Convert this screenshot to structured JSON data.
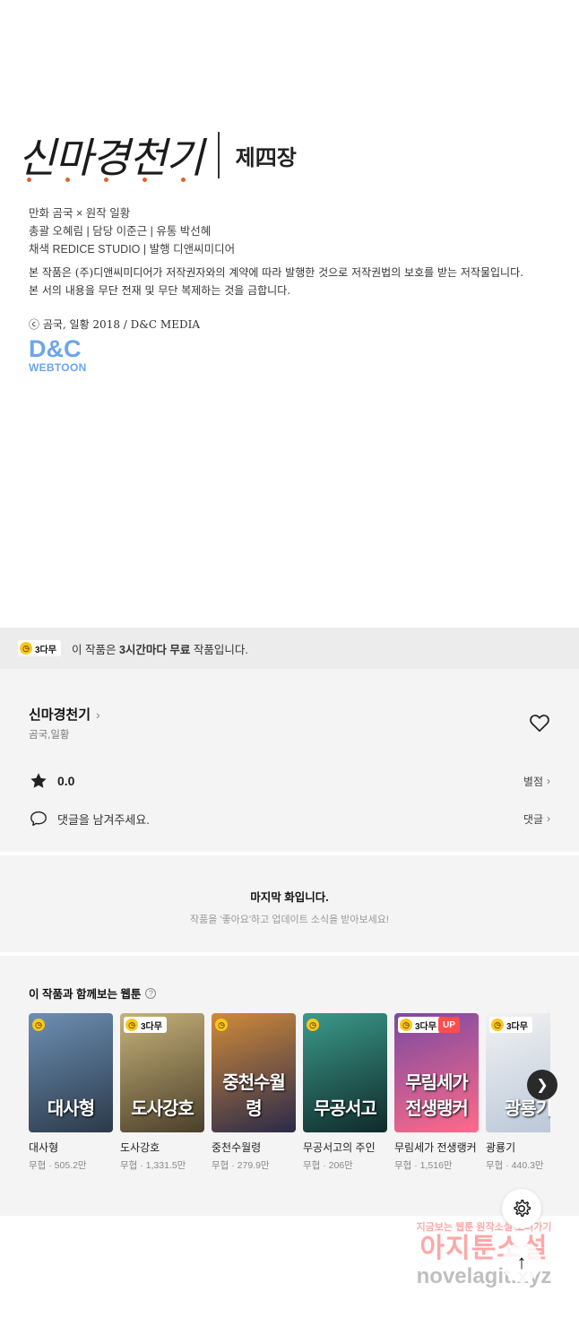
{
  "credit": {
    "title": "신마경천기",
    "chapter": "제四장",
    "lines": [
      "만화 곰국 × 원작 일황",
      "총괄 오혜림 | 담당 이준근 | 유통 박선혜",
      "채색 REDICE STUDIO | 발행 디앤씨미디어"
    ],
    "notice": [
      "본 작품은 (주)디앤씨미디어가 저작권자와의 계약에 따라 발행한 것으로 저작권법의 보호를 받는 저작물입니다.",
      "본 서의 내용을 무단 전재 및 무단 복제하는 것을 금합니다."
    ],
    "copyright": "ⓒ 곰국, 일황 2018 / D&C MEDIA",
    "logo_big": "D&C",
    "logo_small": "WEBTOON"
  },
  "free_bar": {
    "badge": "3다무",
    "prefix": "이 작품은 ",
    "bold": "3시간마다 무료",
    "suffix": " 작품입니다."
  },
  "info": {
    "title": "신마경천기",
    "author": "곰국,일황",
    "rating": "0.0",
    "rating_link": "별점",
    "comment_placeholder": "댓글을 남겨주세요.",
    "comment_link": "댓글"
  },
  "last": {
    "title": "마지막 화입니다.",
    "subtitle": "작품을 '좋아요'하고 업데이트 소식을 받아보세요!"
  },
  "recommend": {
    "title": "이 작품과 함께보는 웹툰",
    "items": [
      {
        "name": "대사형",
        "meta": "무협 · 505.2만",
        "badge": "",
        "up": "",
        "cover_text": "대사형",
        "color1": "#6d8fb3",
        "color2": "#2b3a4a"
      },
      {
        "name": "도사강호",
        "meta": "무협 · 1,331.5만",
        "badge": "3다무",
        "up": "",
        "cover_text": "도사강호",
        "color1": "#c7b27a",
        "color2": "#4a3f2a"
      },
      {
        "name": "중천수월령",
        "meta": "무협 · 279.9만",
        "badge": "",
        "up": "",
        "cover_text": "중천수월령",
        "color1": "#d08a3a",
        "color2": "#2a2a4a"
      },
      {
        "name": "무공서고의 주인",
        "meta": "무협 · 206만",
        "badge": "",
        "up": "",
        "cover_text": "무공서고",
        "color1": "#3b9a8a",
        "color2": "#0f2a2a"
      },
      {
        "name": "무림세가 전생랭커",
        "meta": "무협 · 1,516만",
        "badge": "3다무",
        "up": "UP",
        "cover_text": "무림세가 전생랭커",
        "color1": "#7a4aa0",
        "color2": "#ff6a8a"
      },
      {
        "name": "광룡기",
        "meta": "무협 · 440.3만",
        "badge": "3다무",
        "up": "",
        "cover_text": "광룡기",
        "color1": "#f2f2f2",
        "color2": "#b8c6d8"
      }
    ]
  },
  "watermark": {
    "top": "지금보는 웹툰 원작소설 보러가기",
    "mid": "아지툰소설",
    "bot": "novelagit.xyz"
  }
}
